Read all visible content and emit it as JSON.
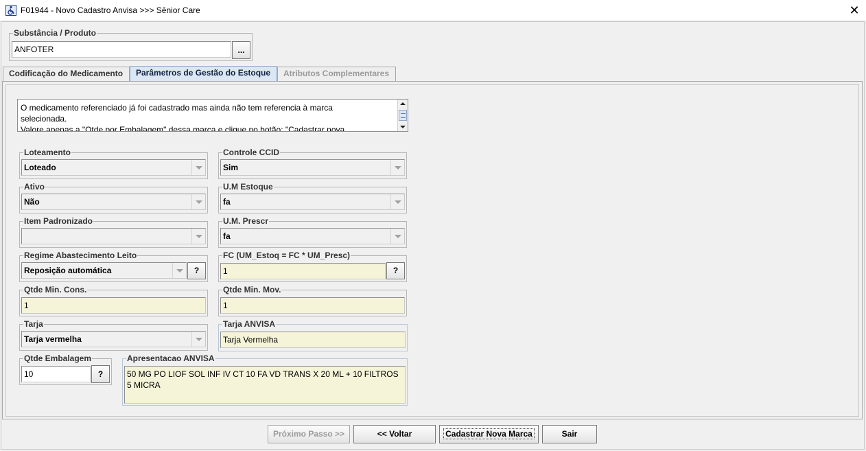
{
  "window": {
    "title": "F01944 - Novo Cadastro Anvisa >>> Sênior Care",
    "close_glyph": "✕"
  },
  "substancia": {
    "label": "Substância / Produto",
    "value": "ANFOTER",
    "browse_label": "..."
  },
  "tabs": [
    {
      "label": "Codificação do Medicamento",
      "state": "normal"
    },
    {
      "label": "Parâmetros de Gestão do Estoque",
      "state": "active"
    },
    {
      "label": "Atributos Complementares",
      "state": "disabled"
    }
  ],
  "info": {
    "line1": "O medicamento referenciado já foi cadastrado mas ainda não tem referencia à marca",
    "line2": "selecionada.",
    "line3": "Valore apenas a \"Qtde por Embalagem\" dessa marca e clique no botão: \"Cadastrar nova"
  },
  "fields": {
    "loteamento": {
      "label": "Loteamento",
      "value": "Loteado"
    },
    "controle_ccid": {
      "label": "Controle CCID",
      "value": "Sim"
    },
    "ativo": {
      "label": "Ativo",
      "value": "Não"
    },
    "um_estoque": {
      "label": "U.M Estoque",
      "value": "fa"
    },
    "item_padronizado": {
      "label": "Item Padronizado",
      "value": ""
    },
    "um_prescr": {
      "label": "U.M. Prescr",
      "value": "fa"
    },
    "regime": {
      "label": "Regime Abastecimento Leito",
      "value": "Reposição automática",
      "help": "?"
    },
    "fc": {
      "label": "FC (UM_Estoq = FC * UM_Presc)",
      "value": "1",
      "help": "?"
    },
    "qtde_min_cons": {
      "label": "Qtde Min. Cons.",
      "value": "1"
    },
    "qtde_min_mov": {
      "label": "Qtde Min. Mov.",
      "value": "1"
    },
    "tarja": {
      "label": "Tarja",
      "value": "Tarja vermelha"
    },
    "tarja_anvisa": {
      "label": "Tarja ANVISA",
      "value": "Tarja Vermelha"
    },
    "qtde_embalagem": {
      "label": "Qtde Embalagem",
      "value": "10",
      "help": "?"
    },
    "apresentacao_anvisa": {
      "label": "Apresentacao ANVISA",
      "value": "50 MG PO LIOF SOL INF IV CT 10 FA VD TRANS X 20 ML + 10 FILTROS 5 MICRA"
    }
  },
  "buttons": {
    "proximo": "Próximo Passo >>",
    "voltar": "<< Voltar",
    "cadastrar": "Cadastrar Nova Marca",
    "sair": "Sair"
  },
  "icons": {
    "app": "wheelchair-app-icon",
    "close": "close-icon",
    "combo": "chevron-down-icon"
  }
}
